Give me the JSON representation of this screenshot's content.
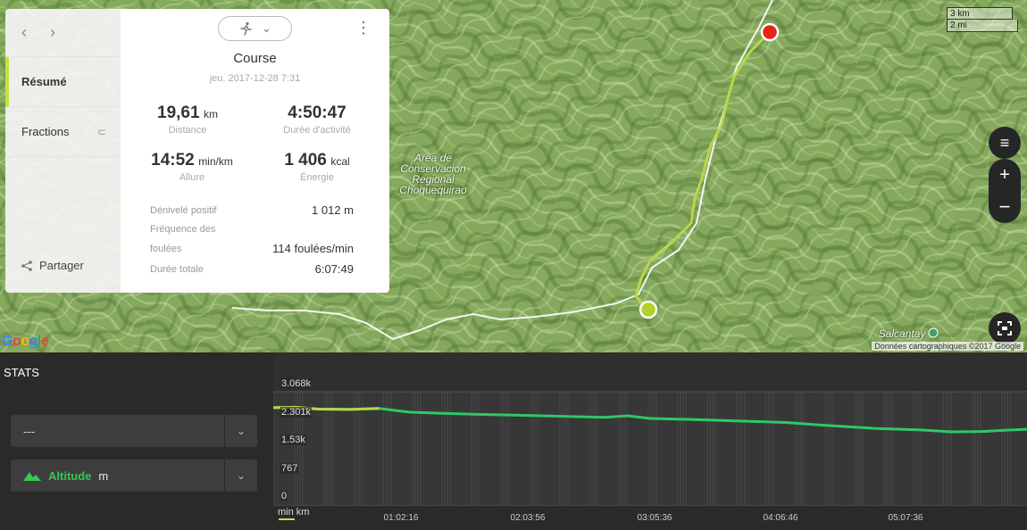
{
  "map": {
    "area_label": "Area de\nConservacion\nRegional\nChoquequirao",
    "peak_label": "Salcantay",
    "scale": [
      "3 km",
      "2 mi"
    ],
    "copyright": "Données cartographiques ©2017 Google",
    "google": "Google",
    "controls": [
      "menu-icon",
      "zoom-in-icon",
      "zoom-out-icon",
      "fullscreen-icon"
    ],
    "colors": {
      "route": "#b9d64a",
      "start": "#b5cf2e",
      "end": "#e5261d"
    }
  },
  "nav": {
    "back": "‹",
    "forward": "›",
    "items": [
      {
        "label": "Résumé",
        "active": true
      },
      {
        "label": "Fractions",
        "active": false
      }
    ],
    "share_label": "Partager"
  },
  "summary": {
    "title": "Course",
    "date": "jeu. 2017-12-28 7:31",
    "distance": {
      "value": "19,61",
      "unit": "km",
      "label": "Distance"
    },
    "duration": {
      "value": "4:50:47",
      "label": "Durée d'activité"
    },
    "pace": {
      "value": "14:52",
      "unit": "min/km",
      "label": "Allure"
    },
    "energy": {
      "value": "1 406",
      "unit": "kcal",
      "label": "Énergie"
    },
    "rows": [
      {
        "label": "Dénivelé positif",
        "value": "1 012 m"
      },
      {
        "label": "Fréquence des",
        "value": ""
      },
      {
        "label": "foulées",
        "value": "114 foulées/min"
      },
      {
        "label": "Durée totale",
        "value": "6:07:49"
      }
    ]
  },
  "stats": {
    "title": "STATS",
    "select1": "---",
    "select2_name": "Altitude",
    "select2_unit": "m",
    "accent": "#34c759"
  },
  "chart_data": {
    "type": "area",
    "y_ticks": [
      "3.068k",
      "2.301k",
      "1.53k",
      "767",
      "0"
    ],
    "x_ticks": [
      "01:02:16",
      "02:03:56",
      "03:05:36",
      "04:06:46",
      "05:07:36"
    ],
    "x_unit_labels": [
      "min",
      "km"
    ],
    "ylim": [
      0,
      3068
    ],
    "x": [
      0,
      0.03,
      0.06,
      0.1,
      0.14,
      0.18,
      0.22,
      0.27,
      0.32,
      0.38,
      0.44,
      0.47,
      0.5,
      0.56,
      0.62,
      0.68,
      0.72,
      0.76,
      0.8,
      0.86,
      0.9,
      0.94,
      0.97,
      1.0
    ],
    "values": [
      2640,
      2650,
      2600,
      2590,
      2620,
      2520,
      2490,
      2460,
      2440,
      2410,
      2380,
      2420,
      2350,
      2320,
      2280,
      2240,
      2180,
      2130,
      2080,
      2040,
      1990,
      2000,
      2030,
      2060
    ]
  }
}
